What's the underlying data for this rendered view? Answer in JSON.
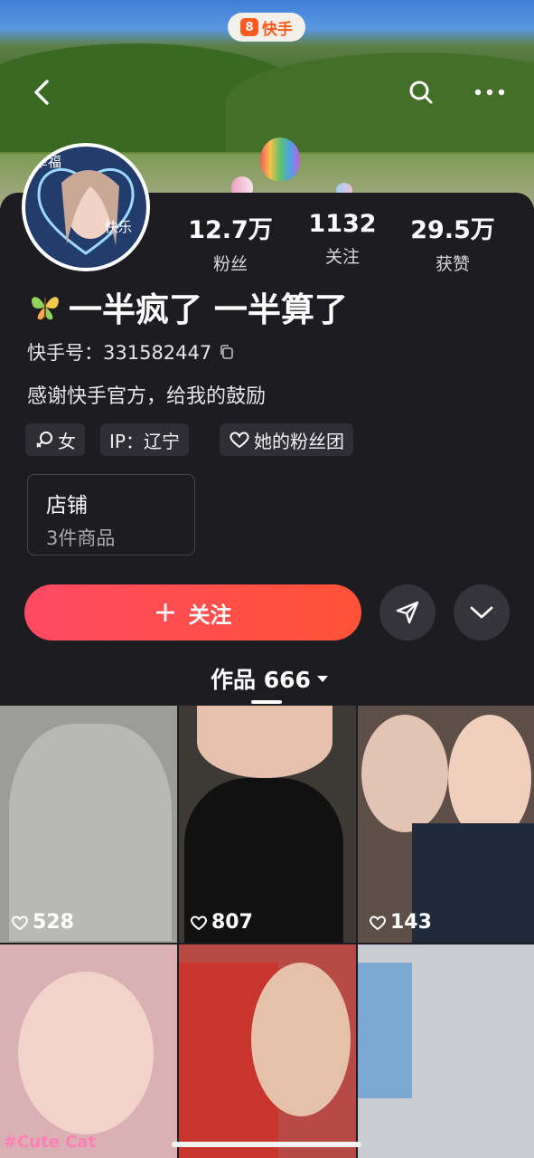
{
  "app": {
    "brand": "快手",
    "brand_mark": "8"
  },
  "topbar": {
    "back_icon": "chevron-left-icon",
    "search_icon": "search-icon",
    "more_icon": "more-dots-icon"
  },
  "profile": {
    "avatar_text_1": "幸福",
    "avatar_text_2": "快乐",
    "name": "一半疯了 一半算了",
    "id_label": "快手号：331582447",
    "bio": "感谢快手官方，给我的鼓励",
    "tags": [
      "女",
      "IP：辽宁",
      "她的粉丝团"
    ]
  },
  "stats": [
    {
      "value": "12.7万",
      "label": "粉丝"
    },
    {
      "value": "1132",
      "label": "关注"
    },
    {
      "value": "29.5万",
      "label": "获赞"
    }
  ],
  "shop": {
    "title": "店铺",
    "subtitle": "3件商品"
  },
  "actions": {
    "follow_label": "关注",
    "follow_icon": "plus-icon",
    "share_icon": "send-icon",
    "expand_icon": "chevron-down-icon"
  },
  "works_tab": {
    "label": "作品 666"
  },
  "videos": [
    {
      "likes": "528",
      "color": "#9c9d99"
    },
    {
      "likes": "807",
      "color": "#3d3a36"
    },
    {
      "likes": "143",
      "color": "#5d4e48"
    },
    {
      "likes": "",
      "color": "#d9b0b4",
      "sticker": "#Cute Cat"
    },
    {
      "likes": "",
      "color": "#b84a45"
    },
    {
      "likes": "",
      "color": "#c9ccd2"
    }
  ],
  "colors": {
    "accent": "#ff4a5c",
    "background": "#1c1c21",
    "brand": "#ff5a1f"
  }
}
